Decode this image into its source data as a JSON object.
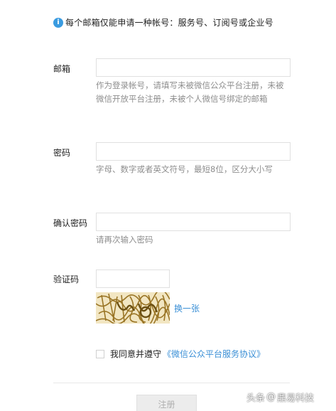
{
  "notice": {
    "icon": "info-icon",
    "text": "每个邮箱仅能申请一种帐号：服务号、订阅号或企业号"
  },
  "email": {
    "label": "邮箱",
    "value": "",
    "hint": "作为登录帐号，请填写未被微信公众平台注册，未被微信开放平台注册，未被个人微信号绑定的邮箱"
  },
  "password": {
    "label": "密码",
    "value": "",
    "hint": "字母、数字或者英文符号，最短8位，区分大小写"
  },
  "confirm": {
    "label": "确认密码",
    "value": "",
    "hint": "请再次输入密码"
  },
  "captcha": {
    "label": "验证码",
    "value": "",
    "refresh": "换一张"
  },
  "agreement": {
    "text": "我同意并遵守",
    "link": "《微信公众平台服务协议》",
    "checked": false
  },
  "submit": {
    "label": "注册"
  },
  "watermark": {
    "prefix": "头条",
    "at": "@",
    "name": "鼎易科技"
  }
}
